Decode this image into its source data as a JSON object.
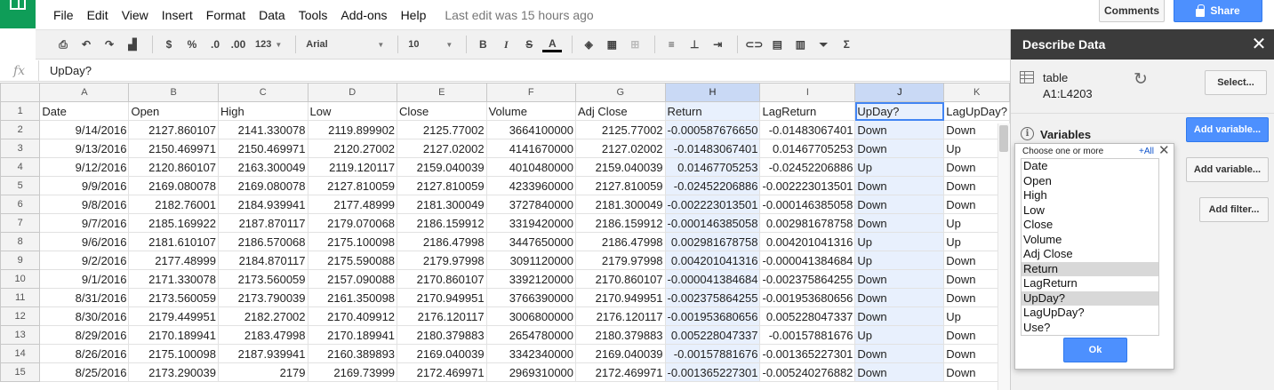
{
  "menu": {
    "items": [
      "File",
      "Edit",
      "View",
      "Insert",
      "Format",
      "Data",
      "Tools",
      "Add-ons",
      "Help"
    ],
    "last_edit": "Last edit was 15 hours ago"
  },
  "header": {
    "comments_label": "Comments",
    "share_label": "Share"
  },
  "toolbar": {
    "currency": "$",
    "percent": "%",
    "decrease_decimals": ".0",
    "increase_decimals": ".00",
    "more_formats": "123",
    "font": "Arial",
    "font_size": "10",
    "bold": "B",
    "italic": "I",
    "strikethrough": "S",
    "text_color": "A",
    "functions": "Σ"
  },
  "formula_bar": {
    "fx": "fx",
    "value": "UpDay?"
  },
  "sheet": {
    "columns": [
      "A",
      "B",
      "C",
      "D",
      "E",
      "F",
      "G",
      "H",
      "I",
      "J",
      "K"
    ],
    "selected_columns": [
      "H",
      "J"
    ],
    "rows": [
      {
        "n": "1",
        "cells": [
          "Date",
          "Open",
          "High",
          "Low",
          "Close",
          "Volume",
          "Adj Close",
          "Return",
          "LagReturn",
          "UpDay?",
          "LagUpDay?"
        ]
      },
      {
        "n": "2",
        "cells": [
          "9/14/2016",
          "2127.860107",
          "2141.330078",
          "2119.899902",
          "2125.77002",
          "3664100000",
          "2125.77002",
          "-0.000587676650",
          "-0.01483067401",
          "Down",
          "Down"
        ]
      },
      {
        "n": "3",
        "cells": [
          "9/13/2016",
          "2150.469971",
          "2150.469971",
          "2120.27002",
          "2127.02002",
          "4141670000",
          "2127.02002",
          "-0.01483067401",
          "0.01467705253",
          "Down",
          "Up"
        ]
      },
      {
        "n": "4",
        "cells": [
          "9/12/2016",
          "2120.860107",
          "2163.300049",
          "2119.120117",
          "2159.040039",
          "4010480000",
          "2159.040039",
          "0.01467705253",
          "-0.02452206886",
          "Up",
          "Down"
        ]
      },
      {
        "n": "5",
        "cells": [
          "9/9/2016",
          "2169.080078",
          "2169.080078",
          "2127.810059",
          "2127.810059",
          "4233960000",
          "2127.810059",
          "-0.02452206886",
          "-0.002223013501",
          "Down",
          "Down"
        ]
      },
      {
        "n": "6",
        "cells": [
          "9/8/2016",
          "2182.76001",
          "2184.939941",
          "2177.48999",
          "2181.300049",
          "3727840000",
          "2181.300049",
          "-0.002223013501",
          "-0.000146385058",
          "Down",
          "Down"
        ]
      },
      {
        "n": "7",
        "cells": [
          "9/7/2016",
          "2185.169922",
          "2187.870117",
          "2179.070068",
          "2186.159912",
          "3319420000",
          "2186.159912",
          "-0.000146385058",
          "0.002981678758",
          "Down",
          "Up"
        ]
      },
      {
        "n": "8",
        "cells": [
          "9/6/2016",
          "2181.610107",
          "2186.570068",
          "2175.100098",
          "2186.47998",
          "3447650000",
          "2186.47998",
          "0.002981678758",
          "0.004201041316",
          "Up",
          "Up"
        ]
      },
      {
        "n": "9",
        "cells": [
          "9/2/2016",
          "2177.48999",
          "2184.870117",
          "2175.590088",
          "2179.97998",
          "3091120000",
          "2179.97998",
          "0.004201041316",
          "-0.000041384684",
          "Up",
          "Down"
        ]
      },
      {
        "n": "10",
        "cells": [
          "9/1/2016",
          "2171.330078",
          "2173.560059",
          "2157.090088",
          "2170.860107",
          "3392120000",
          "2170.860107",
          "-0.000041384684",
          "-0.002375864255",
          "Down",
          "Down"
        ]
      },
      {
        "n": "11",
        "cells": [
          "8/31/2016",
          "2173.560059",
          "2173.790039",
          "2161.350098",
          "2170.949951",
          "3766390000",
          "2170.949951",
          "-0.002375864255",
          "-0.001953680656",
          "Down",
          "Down"
        ]
      },
      {
        "n": "12",
        "cells": [
          "8/30/2016",
          "2179.449951",
          "2182.27002",
          "2170.409912",
          "2176.120117",
          "3006800000",
          "2176.120117",
          "-0.001953680656",
          "0.005228047337",
          "Down",
          "Up"
        ]
      },
      {
        "n": "13",
        "cells": [
          "8/29/2016",
          "2170.189941",
          "2183.47998",
          "2170.189941",
          "2180.379883",
          "2654780000",
          "2180.379883",
          "0.005228047337",
          "-0.00157881676",
          "Up",
          "Down"
        ]
      },
      {
        "n": "14",
        "cells": [
          "8/26/2016",
          "2175.100098",
          "2187.939941",
          "2160.389893",
          "2169.040039",
          "3342340000",
          "2169.040039",
          "-0.00157881676",
          "-0.001365227301",
          "Down",
          "Down"
        ]
      },
      {
        "n": "15",
        "cells": [
          "8/25/2016",
          "2173.290039",
          "2179",
          "2169.73999",
          "2172.469971",
          "2969310000",
          "2172.469971",
          "-0.001365227301",
          "-0.005240276882",
          "Down",
          "Down"
        ]
      }
    ]
  },
  "panel": {
    "title": "Describe Data",
    "table_label": "table",
    "table_range": "A1:L4203",
    "select_label": "Select...",
    "variables_label": "Variables",
    "info_icon": "i",
    "add_variable_label": "Add variable...",
    "add_variable_label_2": "Add variable...",
    "add_filter_label": "Add filter..."
  },
  "variable_picker": {
    "hint": "Choose one or more",
    "all_label": "+All",
    "items": [
      "Date",
      "Open",
      "High",
      "Low",
      "Close",
      "Volume",
      "Adj Close",
      "Return",
      "LagReturn",
      "UpDay?",
      "LagUpDay?",
      "Use?"
    ],
    "highlighted": [
      "Return",
      "UpDay?"
    ],
    "ok_label": "Ok"
  },
  "colors": {
    "accent": "#4d90fe",
    "brand": "#0f9d58",
    "panel_header": "#3b3b3b",
    "selection": "#c9d9f5"
  }
}
